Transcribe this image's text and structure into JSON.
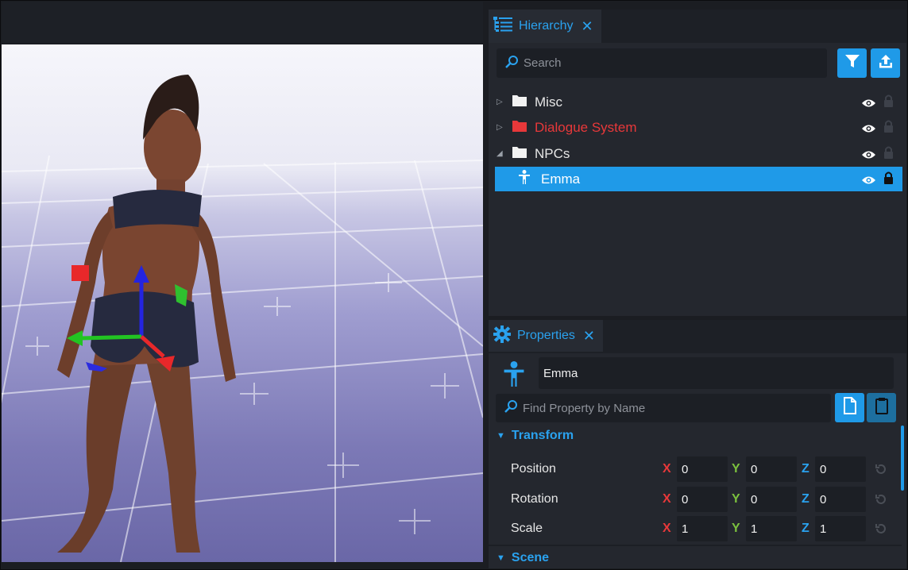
{
  "hierarchy": {
    "tab_label": "Hierarchy",
    "close_glyph": "✕",
    "search_placeholder": "Search",
    "items": [
      {
        "label": "Misc",
        "expanded": false,
        "color": "#e6e6e6",
        "icon": "folder-icon"
      },
      {
        "label": "Dialogue System",
        "expanded": false,
        "color": "#e8383a",
        "icon": "folder-icon"
      },
      {
        "label": "NPCs",
        "expanded": true,
        "color": "#e6e6e6",
        "icon": "folder-icon"
      },
      {
        "label": "Emma",
        "selected": true,
        "color": "#ffffff",
        "icon": "player-icon"
      }
    ]
  },
  "properties": {
    "tab_label": "Properties",
    "close_glyph": "✕",
    "object_name": "Emma",
    "search_placeholder": "Find Property by Name",
    "transform": {
      "title": "Transform",
      "rows": [
        {
          "label": "Position",
          "x": "0",
          "y": "0",
          "z": "0"
        },
        {
          "label": "Rotation",
          "x": "0",
          "y": "0",
          "z": "0"
        },
        {
          "label": "Scale",
          "x": "1",
          "y": "1",
          "z": "1"
        }
      ],
      "axis_labels": {
        "x": "X",
        "y": "Y",
        "z": "Z"
      }
    },
    "scene_title": "Scene"
  },
  "colors": {
    "accent": "#1f9ae8",
    "axis_x": "#e8383a",
    "axis_y": "#7bc13e",
    "axis_z": "#2aa2ef"
  }
}
